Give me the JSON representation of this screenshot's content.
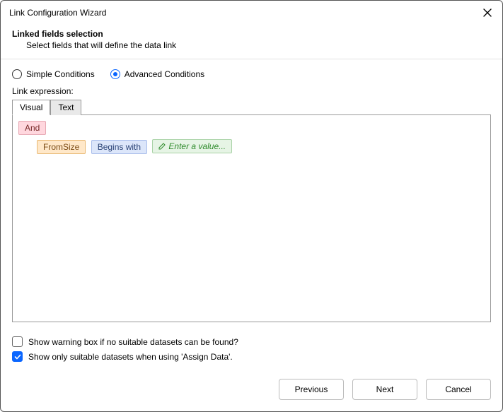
{
  "titlebar": {
    "title": "Link Configuration Wizard"
  },
  "header": {
    "heading": "Linked fields selection",
    "subheading": "Select fields that will define the data link"
  },
  "conditions": {
    "simple_label": "Simple Conditions",
    "advanced_label": "Advanced Conditions",
    "selected": "advanced"
  },
  "expression": {
    "label": "Link expression:",
    "tabs": {
      "visual": "Visual",
      "text": "Text",
      "active": "visual"
    },
    "tree": {
      "group_op": "And",
      "rows": [
        {
          "field": "FromSize",
          "operator": "Begins with",
          "value_placeholder": "Enter a value..."
        }
      ]
    }
  },
  "options": {
    "warn_label": "Show warning box if no suitable datasets can be found?",
    "warn_checked": false,
    "suitable_label": "Show only suitable datasets when using 'Assign Data'.",
    "suitable_checked": true
  },
  "footer": {
    "previous": "Previous",
    "next": "Next",
    "cancel": "Cancel"
  }
}
